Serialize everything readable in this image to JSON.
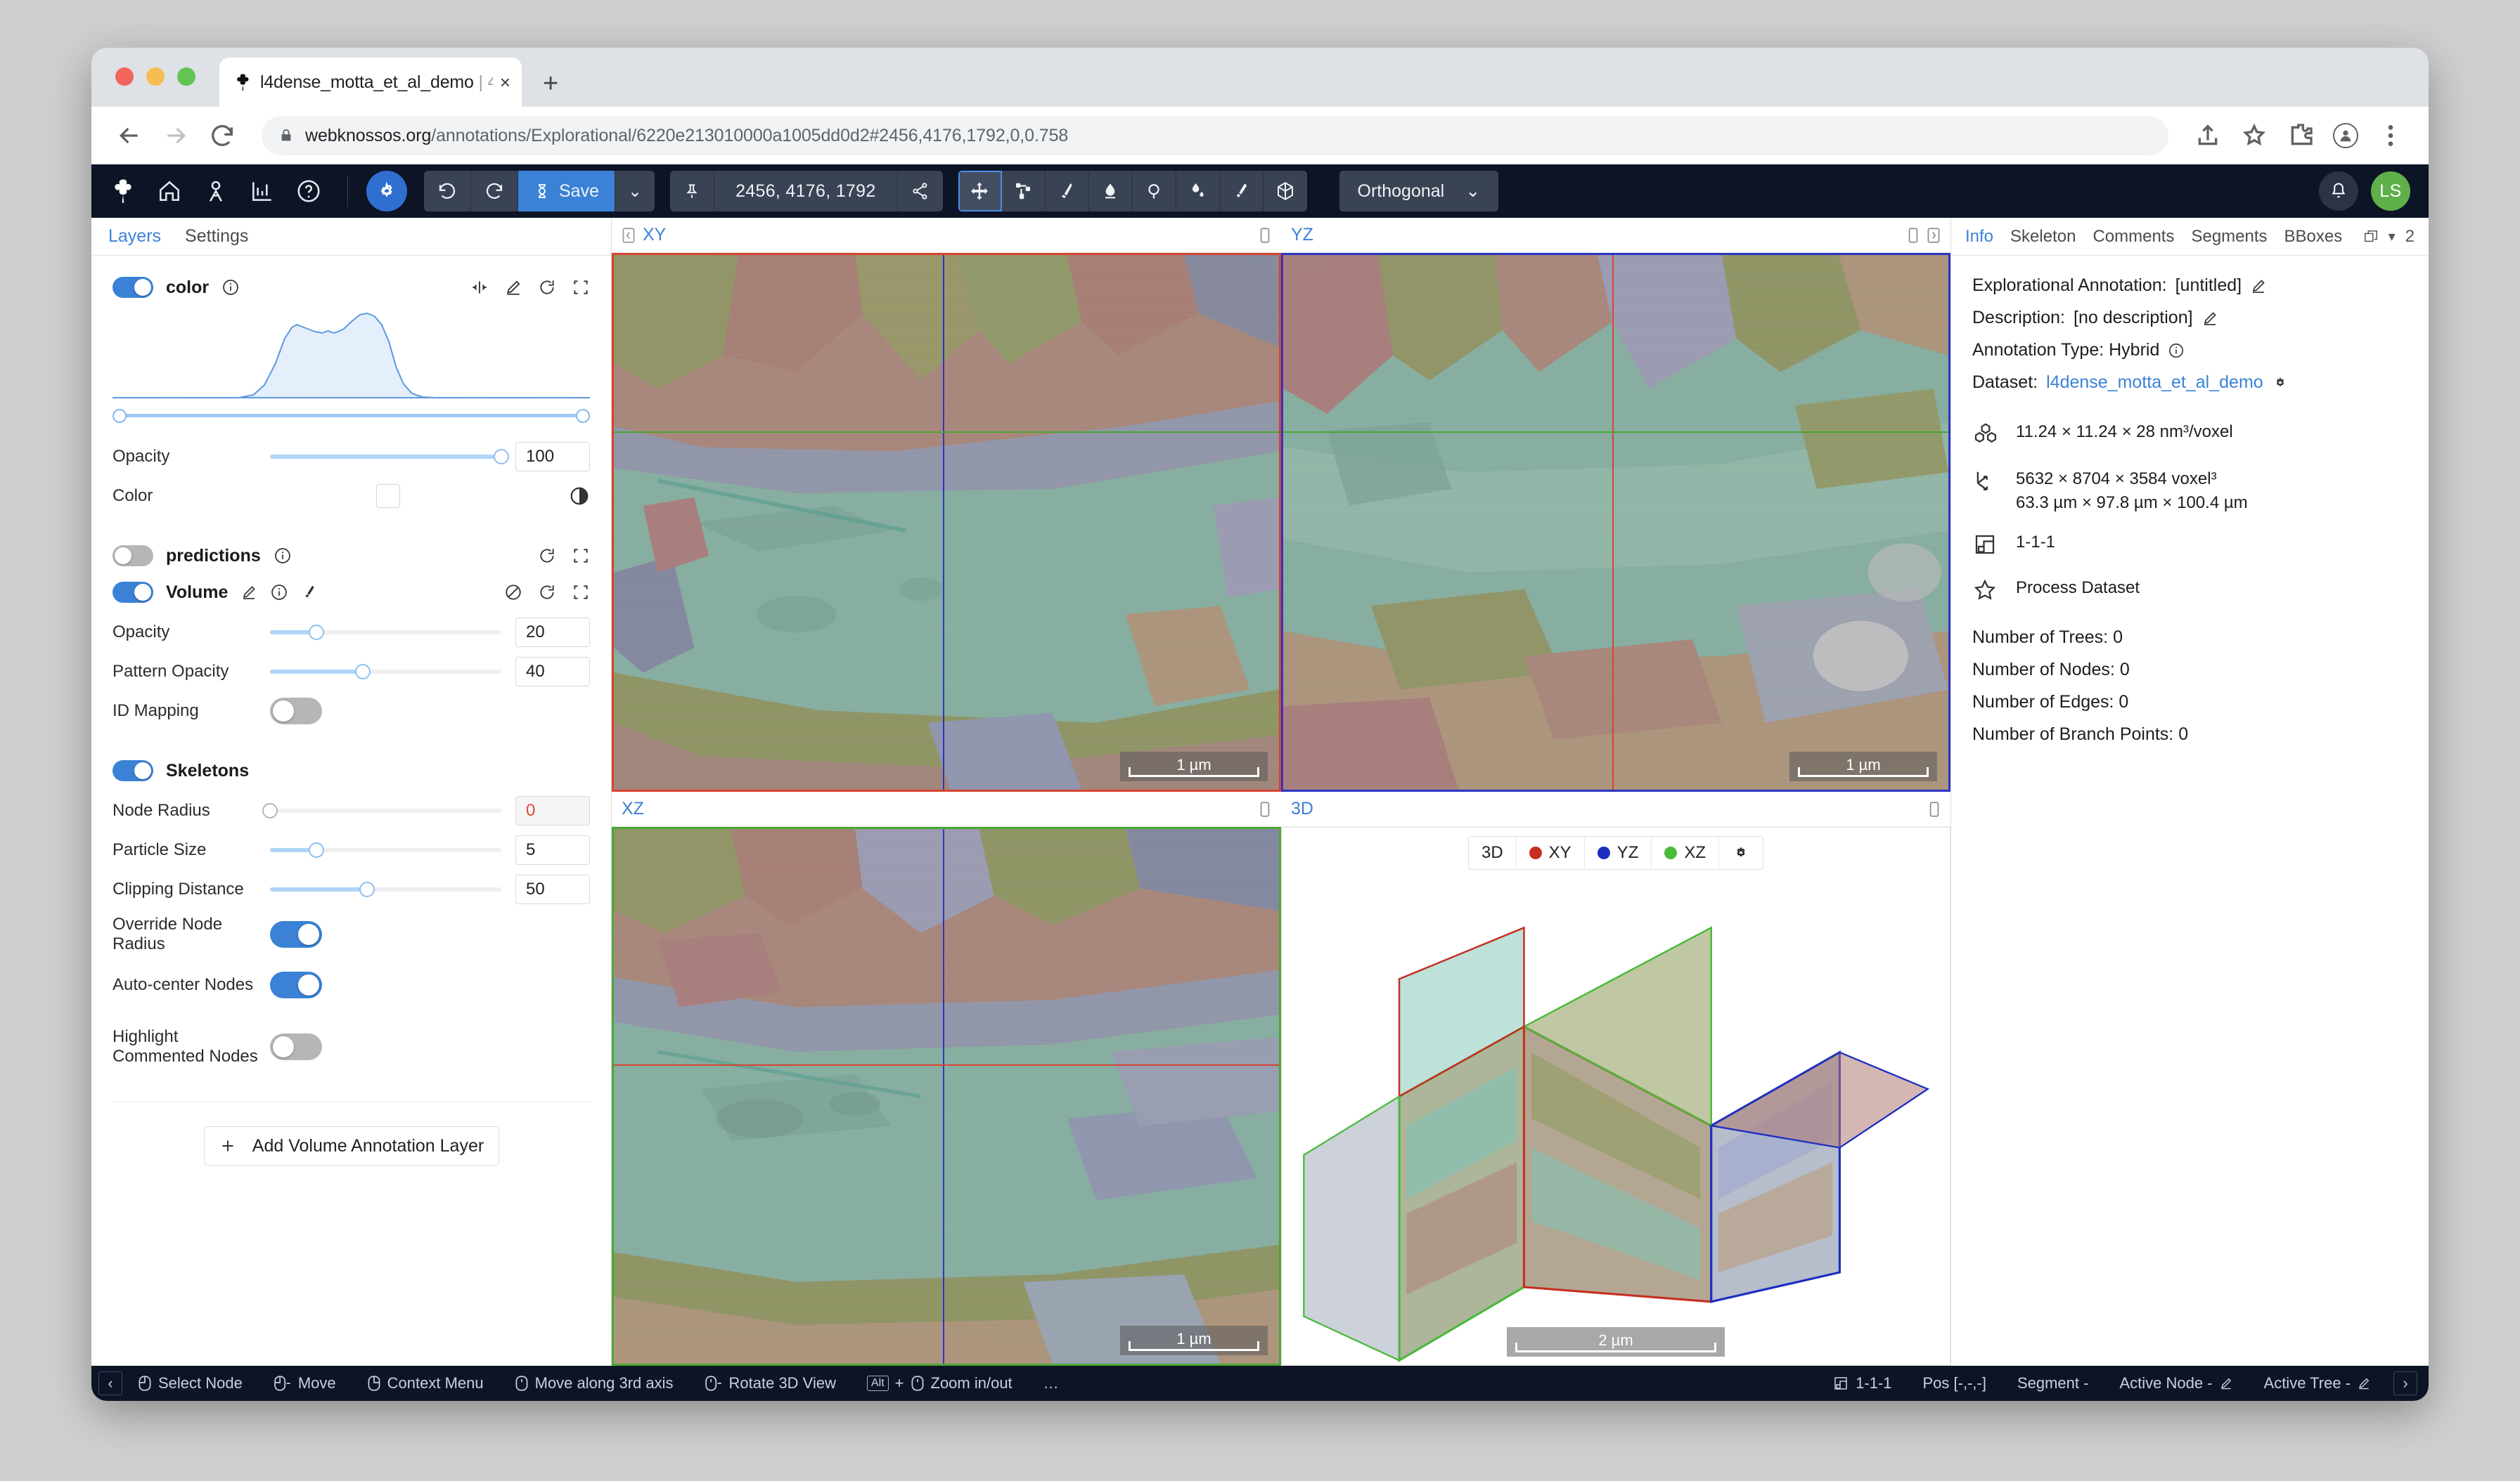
{
  "browser": {
    "tab": {
      "title": "l4dense_motta_et_al_demo",
      "suffix": "| 4",
      "favicon": "clover-icon",
      "close": "×"
    },
    "new_tab": "+",
    "url_host": "webknossos.org",
    "url_path": "/annotations/Explorational/6220e213010000a1005dd0d2#2456,4176,1792,0,0.758"
  },
  "toolbar": {
    "logo": "clover-logo-icon",
    "icons": [
      "home-icon",
      "user-icon",
      "statistics-icon",
      "help-icon"
    ],
    "settings": "gear-icon",
    "undo": "undo-icon",
    "redo": "redo-icon",
    "save_label": "Save",
    "save_icon": "hourglass-icon",
    "save_caret": "⌄",
    "pin_icon": "pin-icon",
    "position": "2456, 4176, 1792",
    "share_icon": "share-icon",
    "tools": [
      "move-tool-icon",
      "skeleton-tool-icon",
      "brush-tool-icon",
      "eraser-tool-icon",
      "trace-tool-icon",
      "fill-tool-icon",
      "pick-cell-tool-icon",
      "bounding-box-tool-icon"
    ],
    "view_mode": "Orthogonal",
    "view_mode_caret": "⌄",
    "bell_icon": "bell-icon",
    "avatar_initials": "LS"
  },
  "sidebar": {
    "tabs": [
      {
        "label": "Layers",
        "active": true
      },
      {
        "label": "Settings",
        "active": false
      }
    ],
    "color_layer": {
      "name": "color",
      "enabled": true,
      "info_icon": "info-icon",
      "actions": [
        "clip-histogram-icon",
        "edit-icon",
        "reload-icon",
        "fit-to-data-icon"
      ],
      "opacity_label": "Opacity",
      "opacity_value": "100",
      "color_label": "Color",
      "invert_icon": "contrast-icon"
    },
    "predictions_layer": {
      "name": "predictions",
      "enabled": false,
      "info_icon": "info-icon",
      "actions": [
        "reload-icon",
        "fit-to-data-icon"
      ]
    },
    "volume_layer": {
      "name": "Volume",
      "enabled": true,
      "icons": [
        "edit-icon",
        "info-icon",
        "brush-icon"
      ],
      "actions": [
        "disable-icon",
        "reload-icon",
        "fit-to-data-icon"
      ],
      "opacity_label": "Opacity",
      "opacity_value": "20",
      "pattern_opacity_label": "Pattern Opacity",
      "pattern_opacity_value": "40",
      "id_mapping_label": "ID Mapping",
      "id_mapping_enabled": false
    },
    "skeletons": {
      "name": "Skeletons",
      "enabled": true,
      "rows": [
        {
          "label": "Node Radius",
          "value": "0",
          "disabled": true,
          "fill": 0
        },
        {
          "label": "Particle Size",
          "value": "5",
          "disabled": false,
          "fill": 20
        },
        {
          "label": "Clipping Distance",
          "value": "50",
          "disabled": false,
          "fill": 40
        }
      ],
      "override_node_radius_label": "Override Node Radius",
      "override_node_radius_enabled": true,
      "auto_center_nodes_label": "Auto-center Nodes",
      "auto_center_nodes_enabled": true,
      "highlight_commented_label": "Highlight Commented Nodes",
      "highlight_commented_enabled": false
    },
    "add_layer_button": "Add Volume Annotation Layer",
    "add_layer_icon": "plus-icon"
  },
  "viewports": [
    {
      "title": "XY",
      "border": "#d64430",
      "scale": "1 µm",
      "left_icon": "prev-slice-icon",
      "right_icon": "maximize-icon"
    },
    {
      "title": "YZ",
      "border": "#2d35c4",
      "scale": "1 µm",
      "left_icon": "",
      "right_icon": "maximize-icon",
      "extra_icon": "next-slice-icon"
    },
    {
      "title": "XZ",
      "border": "#4aa832",
      "scale": "1 µm",
      "left_icon": "",
      "right_icon": "maximize-icon"
    },
    {
      "title": "3D",
      "border": "#ffffff",
      "scale": "2 µm",
      "left_icon": "",
      "right_icon": "maximize-icon"
    }
  ],
  "vp3d_toolbar": {
    "items": [
      {
        "label": "3D",
        "color": ""
      },
      {
        "label": "XY",
        "color": "#c62f21"
      },
      {
        "label": "YZ",
        "color": "#1b2ec0"
      },
      {
        "label": "XZ",
        "color": "#4aba3a"
      }
    ],
    "gear_icon": "gear-icon"
  },
  "rightpanel": {
    "tabs": [
      {
        "label": "Info",
        "active": true
      },
      {
        "label": "Skeleton",
        "active": false
      },
      {
        "label": "Comments",
        "active": false
      },
      {
        "label": "Segments",
        "active": false
      },
      {
        "label": "BBoxes",
        "active": false
      }
    ],
    "restore_icon": "restore-panel-icon",
    "caret": "▾",
    "badge": "2",
    "annotation_label": "Explorational Annotation:",
    "annotation_value": "[untitled]",
    "description_label": "Description:",
    "description_value": "[no description]",
    "edit_icon": "edit-icon",
    "annotation_type_label": "Annotation Type: Hybrid",
    "info_icon": "info-icon",
    "dataset_label": "Dataset:",
    "dataset_value": "l4dense_motta_et_al_demo",
    "dataset_gear": "gear-icon",
    "voxel_size": "11.24 × 11.24 × 28 nm³/voxel",
    "voxel_size_icon": "cubes-icon",
    "extent_voxels": "5632 × 8704 × 3584 voxel³",
    "extent_microns": "63.3 µm × 97.8 µm × 100.4 µm",
    "extent_icon": "axes-icon",
    "mag": "1-1-1",
    "mag_icon": "resolution-icon",
    "process_dataset": "Process Dataset",
    "process_icon": "star-icon",
    "counts": [
      "Number of Trees: 0",
      "Number of Nodes: 0",
      "Number of Edges: 0",
      "Number of Branch Points: 0"
    ]
  },
  "statusbar": {
    "left_arrow": "‹",
    "right_arrow": "›",
    "items": [
      {
        "icon": "mouse-left-icon",
        "label": "Select Node"
      },
      {
        "icon": "mouse-left-drag-icon",
        "label": "Move"
      },
      {
        "icon": "mouse-right-icon",
        "label": "Context Menu"
      },
      {
        "icon": "mouse-wheel-icon",
        "label": "Move along 3rd axis"
      },
      {
        "icon": "mouse-middle-drag-icon",
        "label": "Rotate 3D View"
      },
      {
        "icon": "alt-wheel-icon",
        "label": "Zoom in/out",
        "key": "Alt"
      },
      {
        "icon": "",
        "label": "…"
      }
    ],
    "right_items": [
      {
        "icon": "resolution-icon",
        "label": "1-1-1"
      },
      {
        "icon": "",
        "label": "Pos [-,-,-]"
      },
      {
        "icon": "",
        "label": "Segment -"
      },
      {
        "icon": "edit-icon",
        "label": "Active Node -"
      },
      {
        "icon": "edit-icon",
        "label": "Active Tree -"
      }
    ]
  }
}
